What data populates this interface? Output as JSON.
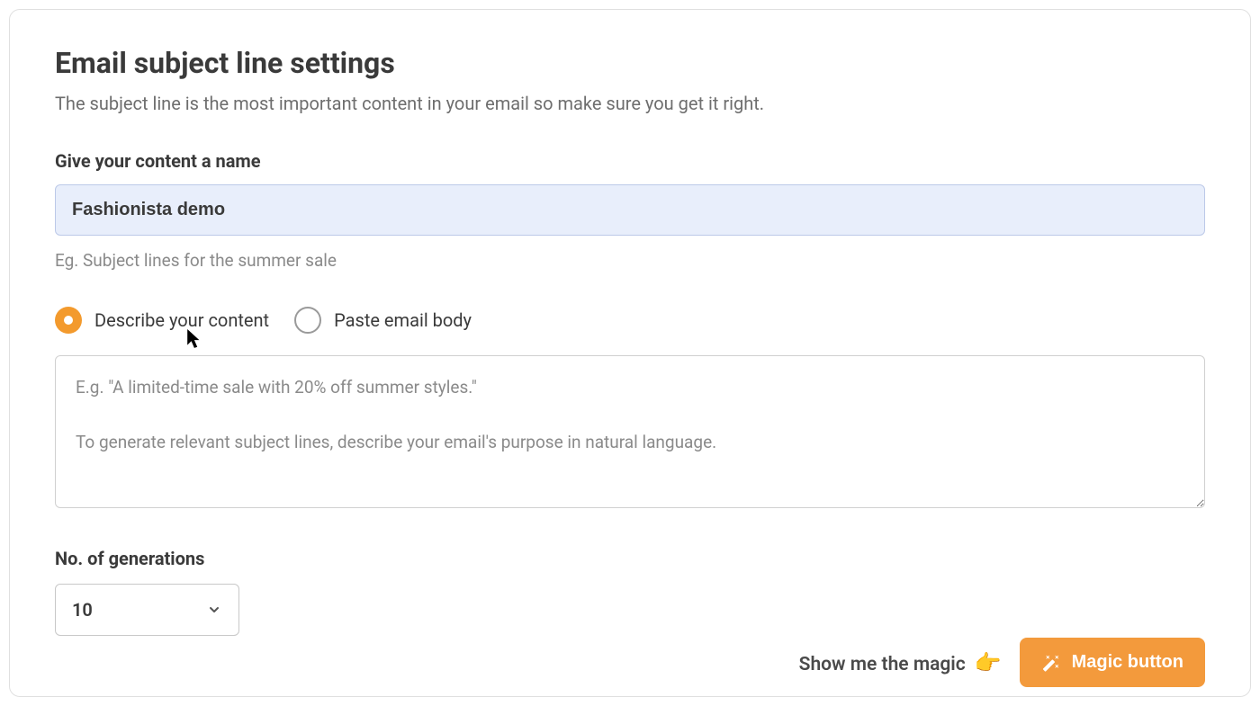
{
  "header": {
    "title": "Email subject line settings",
    "subtitle": "The subject line is the most important content in your email so make sure you get it right."
  },
  "content_name": {
    "label": "Give your content a name",
    "value": "Fashionista demo",
    "hint": "Eg. Subject lines for the summer sale"
  },
  "mode": {
    "options": [
      {
        "label": "Describe your content",
        "selected": true
      },
      {
        "label": "Paste email body",
        "selected": false
      }
    ]
  },
  "description": {
    "placeholder": "E.g. \"A limited-time sale with 20% off summer styles.\"\n\nTo generate relevant subject lines, describe your email's purpose in natural language.",
    "value": ""
  },
  "generations": {
    "label": "No. of generations",
    "value": "10"
  },
  "footer": {
    "cta_text": "Show me the magic",
    "hand_emoji": "👉",
    "button_label": "Magic button"
  }
}
